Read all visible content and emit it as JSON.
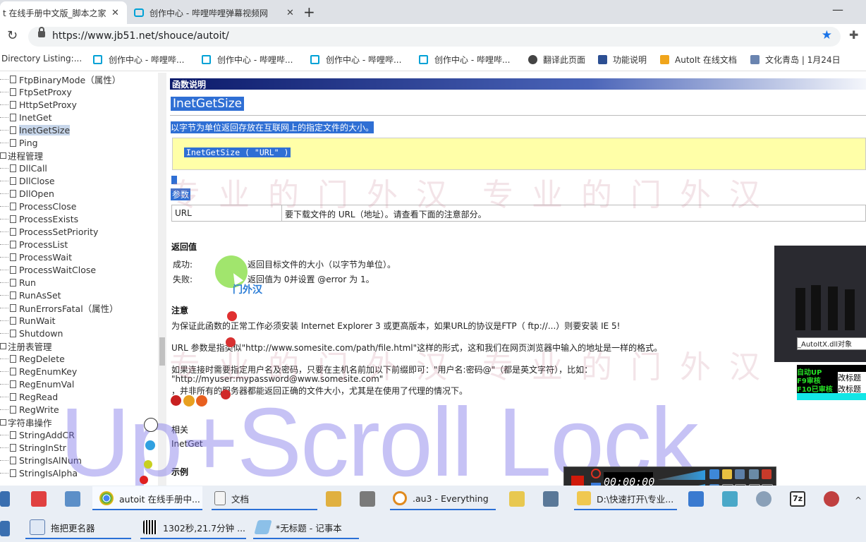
{
  "browser": {
    "tabs": [
      {
        "title": "t 在线手册中文版_脚本之家"
      },
      {
        "title": "创作中心 - 哔哩哔哩弹幕视频网"
      }
    ],
    "url": "https://www.jb51.net/shouce/autoit/",
    "bookmarks": [
      {
        "label": "Directory Listing:...",
        "icon": "folder-icon"
      },
      {
        "label": "创作中心 - 哔哩哔...",
        "icon": "bilibili-icon"
      },
      {
        "label": "创作中心 - 哔哩哔...",
        "icon": "bilibili-icon"
      },
      {
        "label": "创作中心 - 哔哩哔...",
        "icon": "bilibili-icon"
      },
      {
        "label": "创作中心 - 哔哩哔...",
        "icon": "bilibili-icon"
      },
      {
        "label": "翻译此页面",
        "icon": "globe-icon"
      },
      {
        "label": "功能说明",
        "icon": "bookmark-icon"
      },
      {
        "label": "AutoIt 在线文档",
        "icon": "bookmark-icon"
      },
      {
        "label": "文化青岛 | 1月24日",
        "icon": "bookmark-icon"
      }
    ]
  },
  "tree": {
    "items": [
      {
        "label": "FtpBinaryMode（属性）",
        "type": "doc"
      },
      {
        "label": "FtpSetProxy",
        "type": "doc"
      },
      {
        "label": "HttpSetProxy",
        "type": "doc"
      },
      {
        "label": "InetGet",
        "type": "doc"
      },
      {
        "label": "InetGetSize",
        "type": "doc",
        "selected": true
      },
      {
        "label": "Ping",
        "type": "doc"
      },
      {
        "label": "进程管理",
        "type": "folder"
      },
      {
        "label": "DllCall",
        "type": "doc"
      },
      {
        "label": "DllClose",
        "type": "doc"
      },
      {
        "label": "DllOpen",
        "type": "doc"
      },
      {
        "label": "ProcessClose",
        "type": "doc"
      },
      {
        "label": "ProcessExists",
        "type": "doc"
      },
      {
        "label": "ProcessSetPriority",
        "type": "doc"
      },
      {
        "label": "ProcessList",
        "type": "doc"
      },
      {
        "label": "ProcessWait",
        "type": "doc"
      },
      {
        "label": "ProcessWaitClose",
        "type": "doc"
      },
      {
        "label": "Run",
        "type": "doc"
      },
      {
        "label": "RunAsSet",
        "type": "doc"
      },
      {
        "label": "RunErrorsFatal（属性）",
        "type": "doc"
      },
      {
        "label": "RunWait",
        "type": "doc"
      },
      {
        "label": "Shutdown",
        "type": "doc"
      },
      {
        "label": "注册表管理",
        "type": "folder"
      },
      {
        "label": "RegDelete",
        "type": "doc"
      },
      {
        "label": "RegEnumKey",
        "type": "doc"
      },
      {
        "label": "RegEnumVal",
        "type": "doc"
      },
      {
        "label": "RegRead",
        "type": "doc"
      },
      {
        "label": "RegWrite",
        "type": "doc"
      },
      {
        "label": "字符串操作",
        "type": "folder"
      },
      {
        "label": "StringAddCR",
        "type": "doc"
      },
      {
        "label": "StringInStr",
        "type": "doc"
      },
      {
        "label": "StringIsAlNum",
        "type": "doc"
      },
      {
        "label": "StringIsAlpha",
        "type": "doc"
      }
    ]
  },
  "doc": {
    "header": "函数说明",
    "function_name": "InetGetSize",
    "description": "以字节为单位返回存放在互联网上的指定文件的大小。",
    "syntax": "InetGetSize ( \"URL\" )",
    "params_heading": "参数",
    "params": [
      {
        "name": "URL",
        "desc": "要下载文件的 URL（地址）。请查看下面的注意部分。"
      }
    ],
    "return_heading": "返回值",
    "success_label": "成功:",
    "success_text": "返回目标文件的大小（以字节为单位）。",
    "failure_label": "失败:",
    "failure_text": "返回值为 0并设置 @error 为 1。",
    "notes_heading": "注意",
    "note1": "为保证此函数的正常工作必须安装 Internet Explorer 3 或更高版本，如果URL的协议是FTP（ ftp://...）则要安装 IE 5!",
    "note2": "URL 参数是指类似\"http://www.somesite.com/path/file.html\"这样的形式，这和我们在网页浏览器中输入的地址是一样的格式。",
    "note3": "如果连接时需要指定用户名及密码，只要在主机名前加以下前缀即可：\"用户名:密码@\"（都是英文字符），比如：",
    "note4": "\"http://myuser:mypassword@www.somesite.com\"",
    "note5": "，并非所有的服务器都能返回正确的文件大小，尤其是在使用了代理的情况下。",
    "related_heading": "相关",
    "related_link": "InetGet",
    "example_heading": "示例"
  },
  "overlay": {
    "watermark_big": "Up+Scroll Lock",
    "watermark_seal": "专业的门外汉",
    "cursor_tag": "门外汉",
    "autoit_popup": "_AutoItX.dll对象",
    "green_lines": [
      "自动UP",
      "F9审核",
      "F10已审核"
    ],
    "green_buttons": [
      "改标题",
      "改标题"
    ],
    "recorder_counter": "00:00:00"
  },
  "taskbar": {
    "row1": [
      {
        "label": "autoit 在线手册中...",
        "icon": "chrome-icon",
        "active": true
      },
      {
        "label": "文档",
        "icon": "document-icon"
      },
      {
        "label": ".au3 - Everything",
        "icon": "search-icon"
      },
      {
        "label": "D:\\快速打开\\专业...",
        "icon": "folder-icon"
      }
    ],
    "row2": [
      {
        "label": "拖把更名器",
        "icon": "app-icon"
      },
      {
        "label": "1302秒,21.7分钟 ...",
        "icon": "barcode-icon"
      },
      {
        "label": "*无标题 - 记事本",
        "icon": "notepad-icon"
      }
    ]
  },
  "colors": {
    "header_gradient_start": "#0c1a6a",
    "selection": "#2f6fd4",
    "syntax_bg": "#ffffa8",
    "link": "#1f4fc0",
    "chrome_star": "#1a73e8"
  }
}
